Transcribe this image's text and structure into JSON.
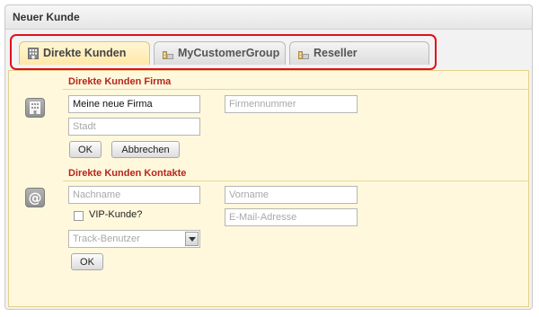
{
  "window": {
    "title": "Neuer Kunde"
  },
  "tabs": [
    {
      "label": "Direkte Kunden",
      "active": true
    },
    {
      "label": "MyCustomerGroup",
      "active": false
    },
    {
      "label": "Reseller",
      "active": false
    }
  ],
  "company": {
    "title": "Direkte Kunden Firma",
    "name_value": "Meine neue Firma",
    "number_placeholder": "Firmennummer",
    "city_placeholder": "Stadt",
    "ok_label": "OK",
    "cancel_label": "Abbrechen"
  },
  "contacts": {
    "title": "Direkte Kunden Kontakte",
    "lastname_placeholder": "Nachname",
    "firstname_placeholder": "Vorname",
    "vip_label": "VIP-Kunde?",
    "email_placeholder": "E-Mail-Adresse",
    "track_user_placeholder": "Track-Benutzer",
    "ok_label": "OK"
  },
  "colors": {
    "highlight": "#e0101a",
    "section_title": "#b8261a",
    "panel_bg": "#fff8dc"
  },
  "icons": {
    "tab": "building-icon",
    "company": "building-icon",
    "contacts": "at-sign-icon",
    "combo": "chevron-down-icon"
  }
}
